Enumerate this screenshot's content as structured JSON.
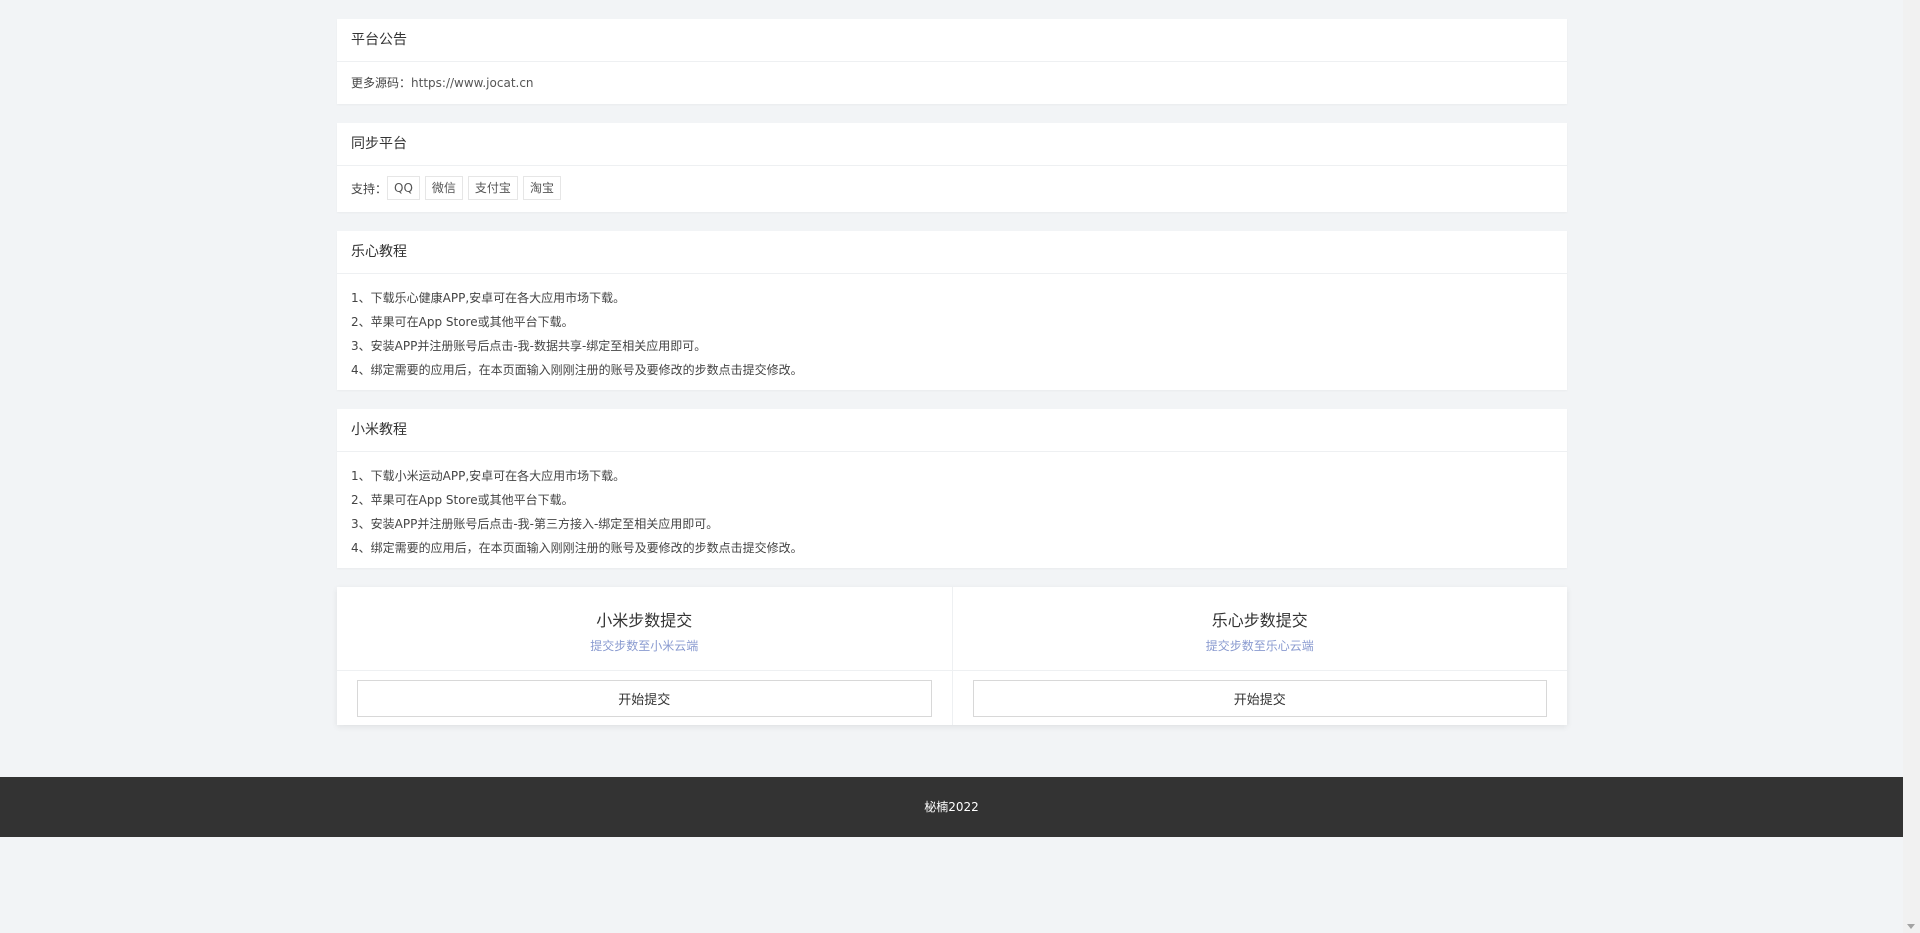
{
  "notice": {
    "title": "平台公告",
    "label": "更多源码：",
    "link": "https://www.jocat.cn"
  },
  "platforms": {
    "title": "同步平台",
    "label": "支持：",
    "tags": [
      "QQ",
      "微信",
      "支付宝",
      "淘宝"
    ]
  },
  "lexin_tutorial": {
    "title": "乐心教程",
    "steps": [
      "1、下载乐心健康APP,安卓可在各大应用市场下载。",
      "2、苹果可在App Store或其他平台下载。",
      "3、安装APP并注册账号后点击-我-数据共享-绑定至相关应用即可。",
      "4、绑定需要的应用后，在本页面输入刚刚注册的账号及要修改的步数点击提交修改。"
    ]
  },
  "xiaomi_tutorial": {
    "title": "小米教程",
    "steps": [
      "1、下载小米运动APP,安卓可在各大应用市场下载。",
      "2、苹果可在App Store或其他平台下载。",
      "3、安装APP并注册账号后点击-我-第三方接入-绑定至相关应用即可。",
      "4、绑定需要的应用后，在本页面输入刚刚注册的账号及要修改的步数点击提交修改。"
    ]
  },
  "xiaomi_submit": {
    "title": "小米步数提交",
    "subtitle": "提交步数至小米云端",
    "button": "开始提交"
  },
  "lexin_submit": {
    "title": "乐心步数提交",
    "subtitle": "提交步数至乐心云端",
    "button": "开始提交"
  },
  "footer": {
    "text": "柲楠2022"
  }
}
